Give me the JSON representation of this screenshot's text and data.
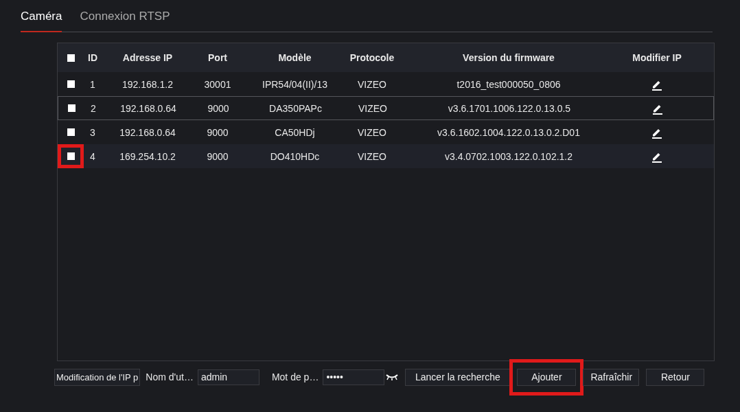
{
  "tabs": [
    {
      "label": "Caméra",
      "selected": true
    },
    {
      "label": "Connexion RTSP",
      "selected": false
    }
  ],
  "table": {
    "select_all_checked": false,
    "columns": [
      "ID",
      "Adresse IP",
      "Port",
      "Modèle",
      "Protocole",
      "Version du firmware",
      "Modifier IP"
    ],
    "rows": [
      {
        "checked": false,
        "hovered": false,
        "highlighted": false,
        "cells": [
          "1",
          "192.168.1.2",
          "30001",
          "IPR54/04(II)/13",
          "VIZEO",
          "t2016_test000050_0806"
        ]
      },
      {
        "checked": false,
        "hovered": true,
        "highlighted": false,
        "cells": [
          "2",
          "192.168.0.64",
          "9000",
          "DA350PAPc",
          "VIZEO",
          "v3.6.1701.1006.122.0.13.0.5"
        ]
      },
      {
        "checked": false,
        "hovered": false,
        "highlighted": false,
        "cells": [
          "3",
          "192.168.0.64",
          "9000",
          "CA50HDj",
          "VIZEO",
          "v3.6.1602.1004.122.0.13.0.2.D01"
        ]
      },
      {
        "checked": false,
        "hovered": false,
        "highlighted": true,
        "cells": [
          "4",
          "169.254.10.2",
          "9000",
          "DO410HDc",
          "VIZEO",
          "v3.4.0702.1003.122.0.102.1.2"
        ]
      }
    ]
  },
  "footer": {
    "mode_button": "Modification de l'IP p",
    "username_label": "Nom d'ut…",
    "username": "admin",
    "password_label": "Mot de p…",
    "password": "•••••",
    "buttons": [
      {
        "label": "Lancer la recherche",
        "highlighted": false
      },
      {
        "label": "Ajouter",
        "highlighted": true
      },
      {
        "label": "Rafraîchir",
        "highlighted": false
      },
      {
        "label": "Retour",
        "highlighted": false
      }
    ]
  }
}
